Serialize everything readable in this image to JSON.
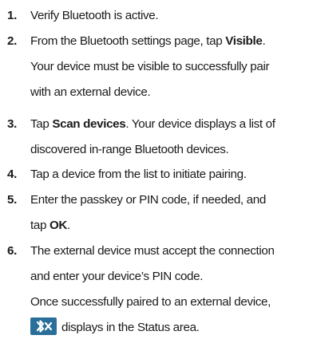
{
  "steps": [
    {
      "number": "1.",
      "text": "Verify Bluetooth is active."
    },
    {
      "number": "2.",
      "text_before": "From the Bluetooth settings page, tap ",
      "bold": "Visible",
      "text_after": ".",
      "note_line1": "Your device must be visible to successfully pair",
      "note_line2": "with an external device."
    },
    {
      "number": "3.",
      "text_bold": "Tap ",
      "bold": "Scan devices",
      "text_after": ". Your device displays a list of",
      "line2": "discovered in-range Bluetooth devices."
    },
    {
      "number": "4.",
      "text": "Tap a device from the list to initiate pairing."
    },
    {
      "number": "5.",
      "line1": "Enter the passkey or PIN code, if needed, and",
      "line2_before": "tap ",
      "bold": "OK",
      "line2_after": "."
    },
    {
      "number": "6.",
      "line1": "The external device must accept the connection",
      "line2": "and enter your device’s PIN code.",
      "note_line1": "Once successfully paired to an external device,",
      "note_line2": "displays in the Status area."
    }
  ],
  "icon": {
    "name": "bluetooth-connected-icon",
    "background": "#2a6f9a",
    "foreground": "#ffffff"
  }
}
